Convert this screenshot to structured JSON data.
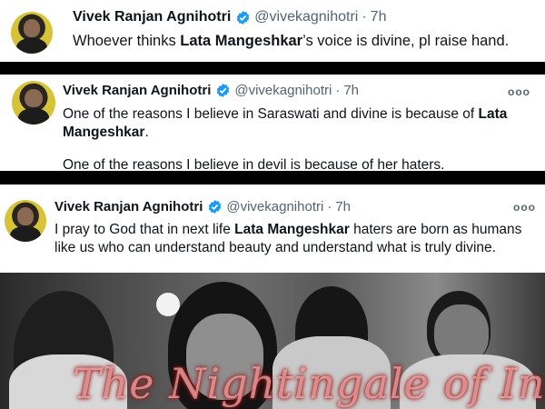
{
  "tweets": [
    {
      "name": "Vivek Ranjan Agnihotri",
      "handle": "@vivekagnihotri",
      "separator": "·",
      "time": "7h",
      "more": "",
      "text_1a": "Whoever thinks ",
      "text_1b": "Lata Mangeshkar",
      "text_1c": "’s voice is divine, pl raise hand."
    },
    {
      "name": "Vivek Ranjan Agnihotri",
      "handle": "@vivekagnihotri",
      "separator": "·",
      "time": "7h",
      "more": "ooo",
      "para1_a": "One of the reasons I believe in Saraswati and divine is because of ",
      "para1_b": "Lata Mangeshkar",
      "para1_c": ".",
      "para2": "One of the reasons I believe in devil is because of her haters."
    },
    {
      "name": "Vivek Ranjan Agnihotri",
      "handle": "@vivekagnihotri",
      "separator": "·",
      "time": "7h",
      "more": "ooo",
      "text_a": "I pray to God that in next life ",
      "text_b": "Lata Mangeshkar",
      "text_c": " haters are born as humans like us who can understand beauty and understand what is truly divine."
    }
  ],
  "photo": {
    "caption": "The Nightingale of India"
  },
  "colors": {
    "verified_badge": "#1d9bf0",
    "secondary_text": "#536471",
    "primary_text": "#0f1419",
    "background": "#000000",
    "card": "#ffffff"
  },
  "icons": {
    "verified": "verified-badge-icon",
    "more": "more-options-icon"
  }
}
